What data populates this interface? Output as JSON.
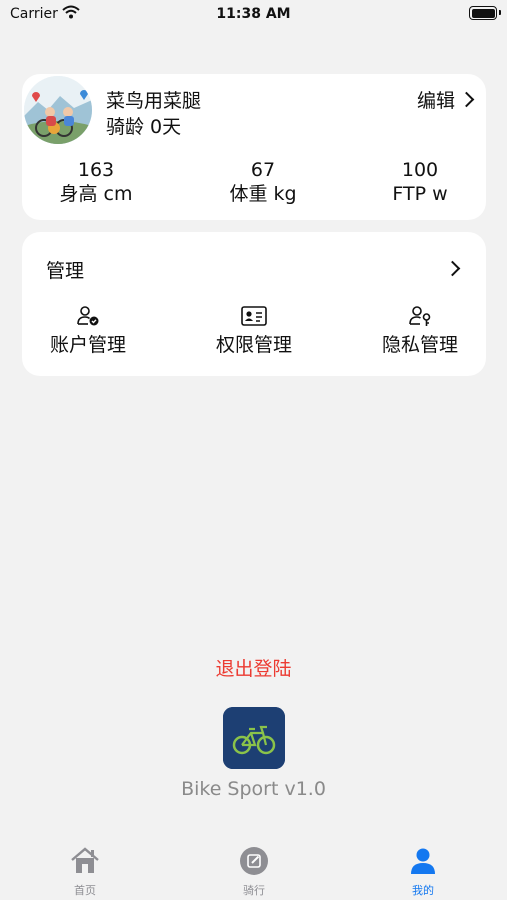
{
  "status_bar": {
    "carrier": "Carrier",
    "time": "11:38 AM"
  },
  "profile": {
    "nickname": "菜鸟用菜腿",
    "riding_age": "骑龄  0天",
    "edit_label": "编辑",
    "stats": [
      {
        "value": "163",
        "label": "身高 cm"
      },
      {
        "value": "67",
        "label": "体重 kg"
      },
      {
        "value": "100",
        "label": "FTP w"
      }
    ]
  },
  "management": {
    "title": "管理",
    "items": [
      {
        "label": "账户管理",
        "icon": "user-check-icon"
      },
      {
        "label": "权限管理",
        "icon": "id-card-icon"
      },
      {
        "label": "隐私管理",
        "icon": "user-key-icon"
      }
    ]
  },
  "logout_label": "退出登陆",
  "app_version": "Bike Sport  v1.0",
  "tabs": [
    {
      "label": "首页",
      "icon": "home-icon",
      "active": false
    },
    {
      "label": "骑行",
      "icon": "edit-circle-icon",
      "active": false
    },
    {
      "label": "我的",
      "icon": "person-icon",
      "active": true
    }
  ],
  "colors": {
    "accent": "#1478f0",
    "logout": "#ec3b32",
    "logo_bg": "#1d3f73",
    "background": "#f2f2f2"
  }
}
